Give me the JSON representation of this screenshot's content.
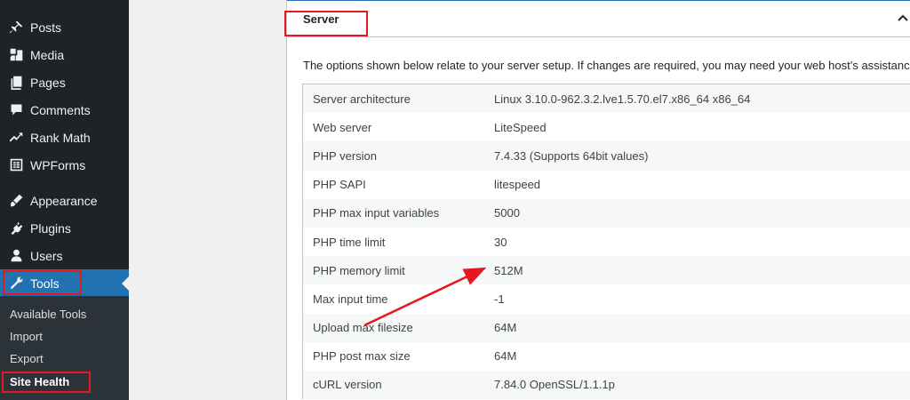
{
  "sidebar": {
    "items": [
      {
        "label": "Posts",
        "icon": "pin-icon"
      },
      {
        "label": "Media",
        "icon": "media-icon"
      },
      {
        "label": "Pages",
        "icon": "pages-icon"
      },
      {
        "label": "Comments",
        "icon": "comments-icon"
      },
      {
        "label": "Rank Math",
        "icon": "rank-math-icon"
      },
      {
        "label": "WPForms",
        "icon": "wpforms-icon"
      },
      {
        "label": "Appearance",
        "icon": "appearance-icon"
      },
      {
        "label": "Plugins",
        "icon": "plugins-icon"
      },
      {
        "label": "Users",
        "icon": "users-icon"
      },
      {
        "label": "Tools",
        "icon": "tools-icon"
      }
    ],
    "active": "Tools",
    "submenu": [
      "Available Tools",
      "Import",
      "Export",
      "Site Health"
    ],
    "current_submenu": "Site Health"
  },
  "panel": {
    "title": "Server",
    "description": "The options shown below relate to your server setup. If changes are required, you may need your web host’s assistance.",
    "rows": [
      {
        "label": "Server architecture",
        "value": "Linux 3.10.0-962.3.2.lve1.5.70.el7.x86_64 x86_64"
      },
      {
        "label": "Web server",
        "value": "LiteSpeed"
      },
      {
        "label": "PHP version",
        "value": "7.4.33 (Supports 64bit values)"
      },
      {
        "label": "PHP SAPI",
        "value": "litespeed"
      },
      {
        "label": "PHP max input variables",
        "value": "5000"
      },
      {
        "label": "PHP time limit",
        "value": "30"
      },
      {
        "label": "PHP memory limit",
        "value": "512M"
      },
      {
        "label": "Max input time",
        "value": "-1"
      },
      {
        "label": "Upload max filesize",
        "value": "64M"
      },
      {
        "label": "PHP post max size",
        "value": "64M"
      },
      {
        "label": "cURL version",
        "value": "7.84.0 OpenSSL/1.1.1p"
      }
    ]
  },
  "colors": {
    "sidebar": "#1d2327",
    "active": "#2271b1",
    "highlight": "#e5171f"
  }
}
